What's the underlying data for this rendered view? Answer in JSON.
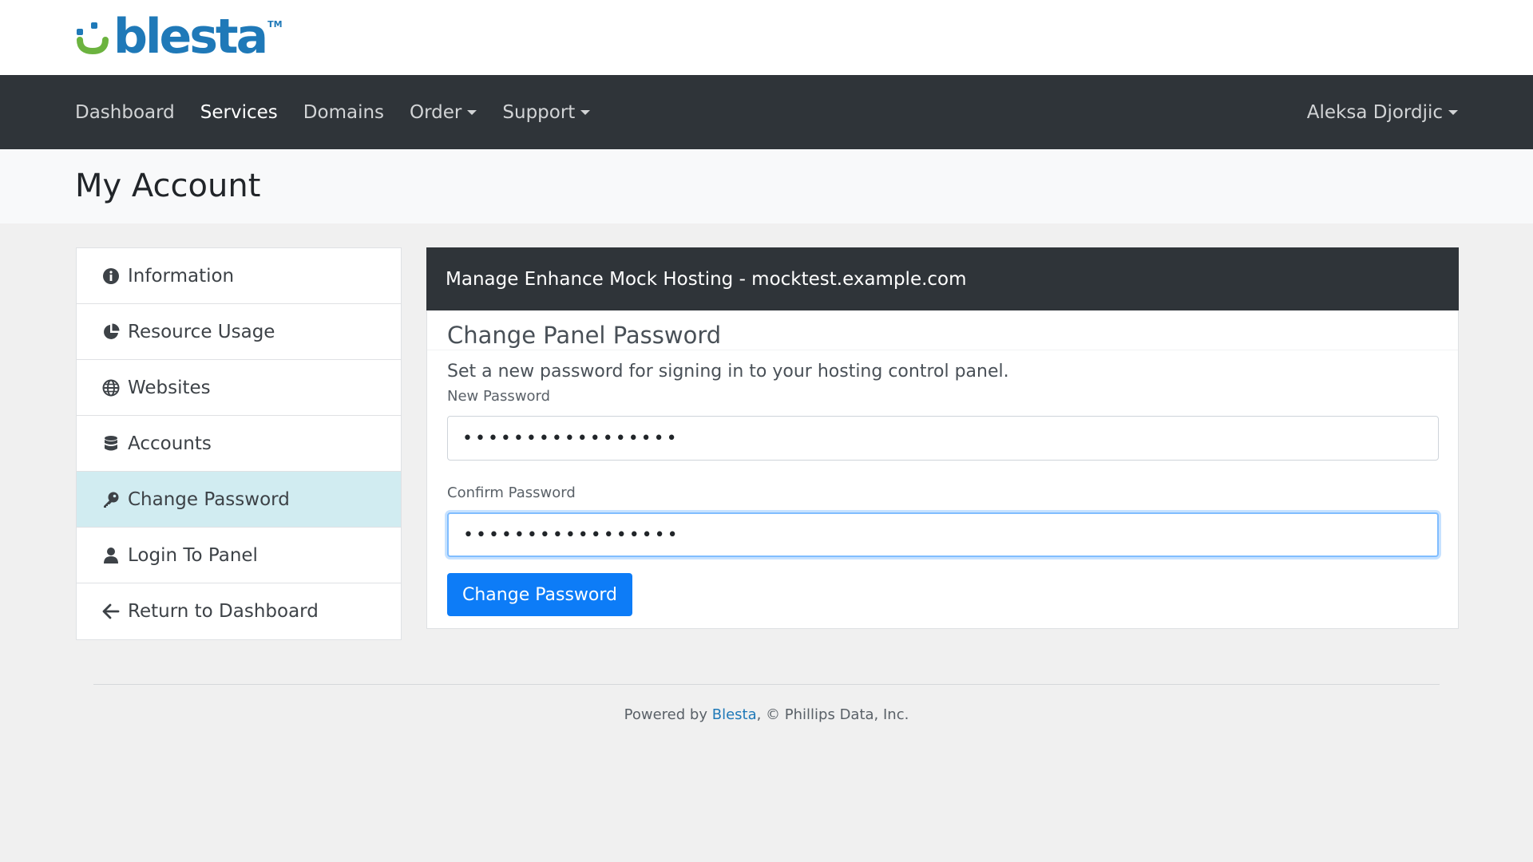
{
  "brand": {
    "logo_text": "blesta",
    "logo_tm": "TM",
    "logo_color": "#1f79b8",
    "logo_icon_color": "#6cb33f"
  },
  "nav": {
    "items": [
      {
        "label": "Dashboard",
        "active": false
      },
      {
        "label": "Services",
        "active": true
      },
      {
        "label": "Domains",
        "active": false
      },
      {
        "label": "Order",
        "dropdown": true
      },
      {
        "label": "Support",
        "dropdown": true
      }
    ],
    "user_label": "Aleksa Djordjic"
  },
  "page": {
    "title": "My Account"
  },
  "sidebar": {
    "items": [
      {
        "label": "Information",
        "icon": "info-circle-icon"
      },
      {
        "label": "Resource Usage",
        "icon": "pie-chart-icon"
      },
      {
        "label": "Websites",
        "icon": "globe-icon"
      },
      {
        "label": "Accounts",
        "icon": "database-icon"
      },
      {
        "label": "Change Password",
        "icon": "key-icon",
        "active": true
      },
      {
        "label": "Login To Panel",
        "icon": "user-icon"
      },
      {
        "label": "Return to Dashboard",
        "icon": "arrow-left-icon"
      }
    ]
  },
  "panel": {
    "header": "Manage Enhance Mock Hosting - mocktest.example.com",
    "section_title": "Change Panel Password",
    "description": "Set a new password for signing in to your hosting control panel.",
    "new_password_label": "New Password",
    "new_password_value": "•••••••••••••••••",
    "confirm_password_label": "Confirm Password",
    "confirm_password_value": "•••••••••••••••••",
    "submit_label": "Change Password"
  },
  "footer": {
    "prefix": "Powered by ",
    "link": "Blesta",
    "suffix": ", © Phillips Data, Inc."
  },
  "colors": {
    "navbar_bg": "#2f3439",
    "active_sidebar_bg": "#d1ecf1",
    "primary_button": "#0d7cf7"
  }
}
